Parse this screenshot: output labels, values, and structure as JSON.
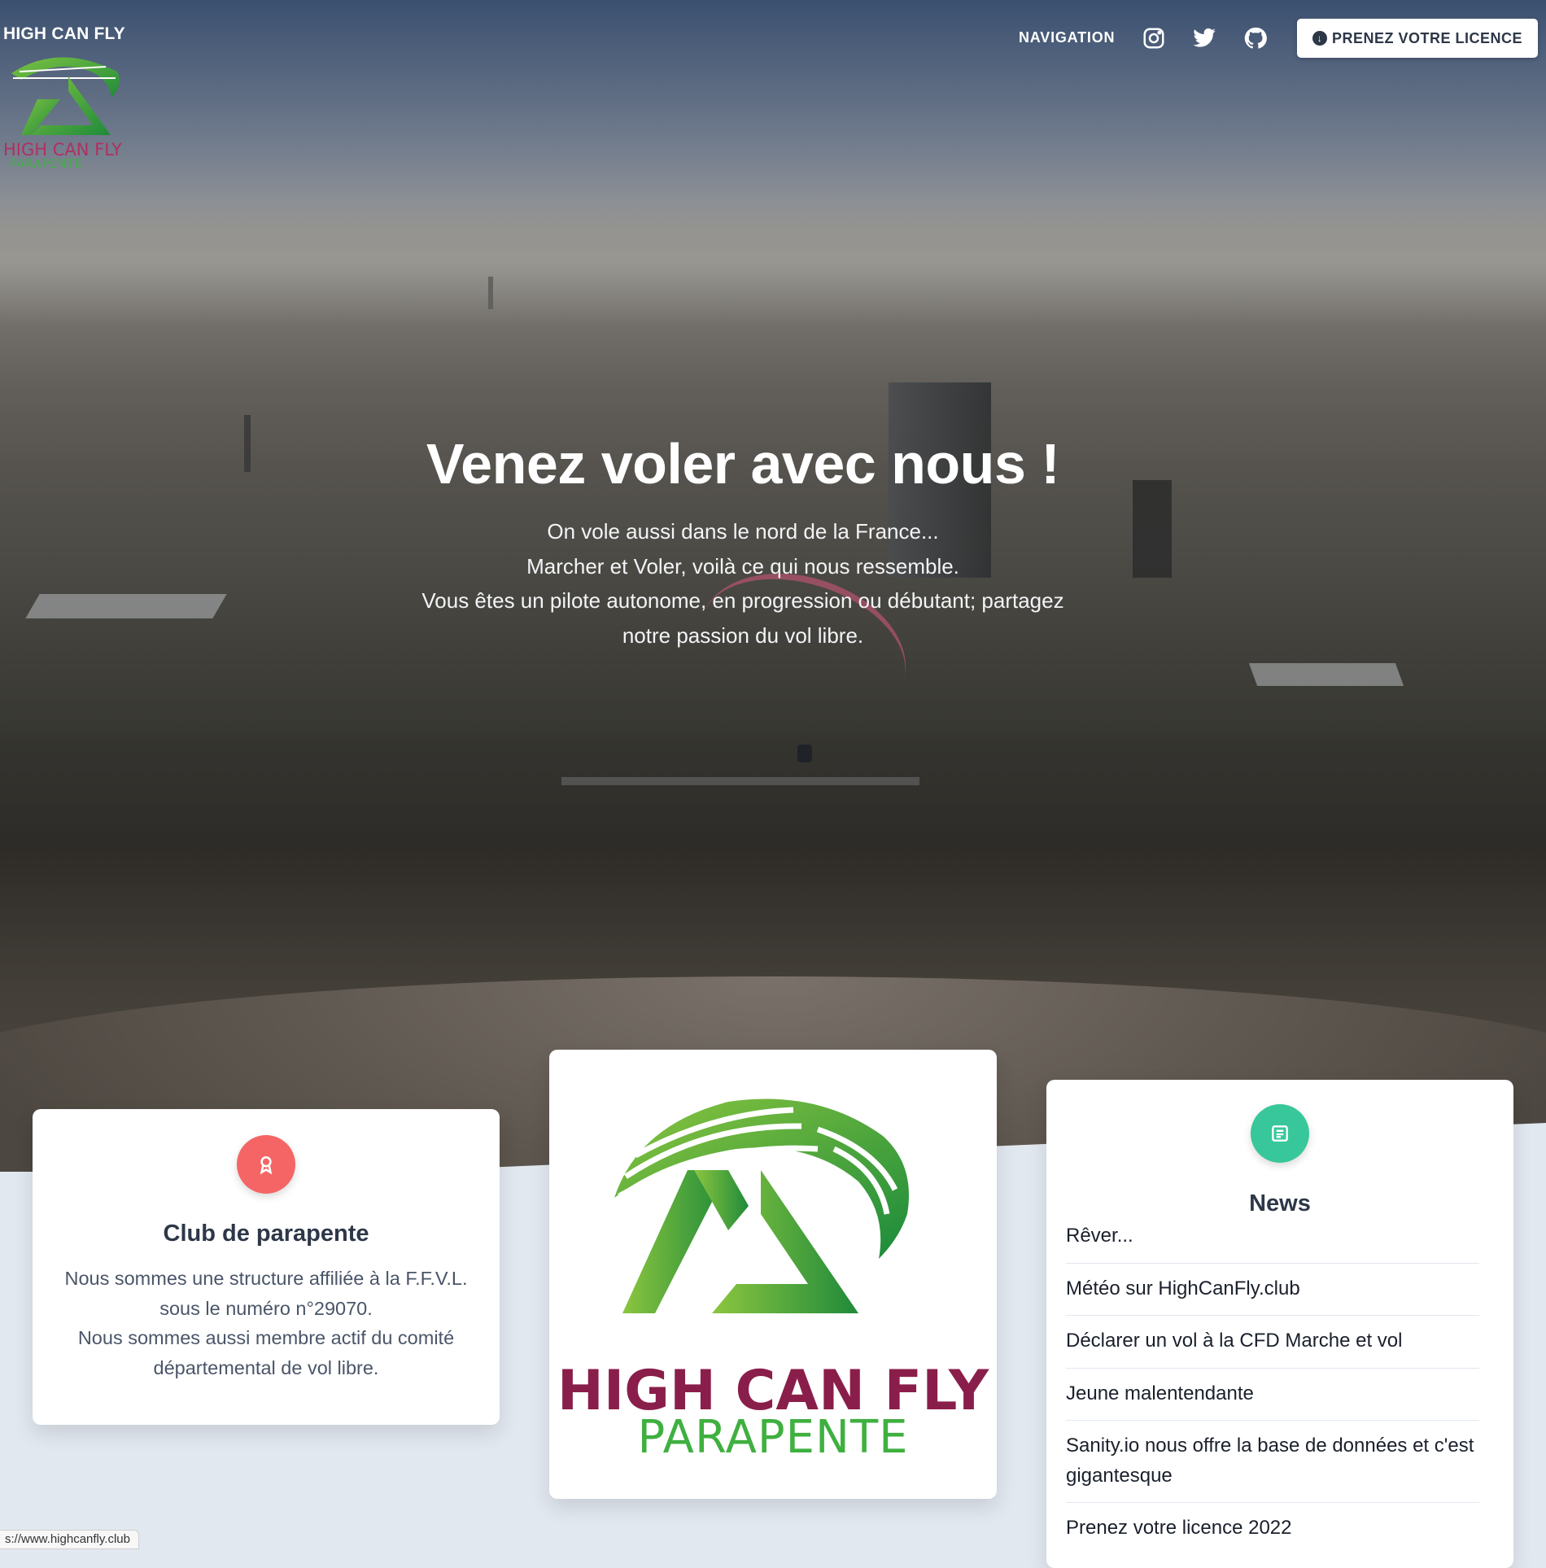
{
  "header": {
    "brand": "HIGH CAN FLY",
    "logo_title": "HIGH CAN FLY",
    "logo_subtitle": "PARAPENTE",
    "nav_link": "NAVIGATION",
    "social_icons": [
      "instagram-icon",
      "twitter-icon",
      "github-icon"
    ],
    "cta_label": "PRENEZ VOTRE LICENCE"
  },
  "hero": {
    "title": "Venez voler avec nous !",
    "lines": [
      "On vole aussi dans le nord de la France...",
      "Marcher et Voler, voilà ce qui nous ressemble.",
      "Vous êtes un pilote autonome, en progression ou débutant; partagez",
      "notre passion du vol libre."
    ]
  },
  "cards": {
    "club": {
      "icon": "award-icon",
      "title": "Club de parapente",
      "lines": [
        "Nous sommes une structure affiliée à la F.F.V.L.",
        "sous le numéro n°29070.",
        "Nous sommes aussi membre actif du comité",
        "départemental de vol libre."
      ]
    },
    "logo": {
      "title": "HIGH CAN FLY",
      "subtitle": "PARAPENTE"
    },
    "news": {
      "icon": "newspaper-icon",
      "title": "News",
      "items": [
        "Rêver...",
        "Météo sur HighCanFly.club",
        "Déclarer un vol à la CFD Marche et vol",
        "Jeune malentendante",
        "Sanity.io nous offre la base de données et c'est gigantesque",
        "Prenez votre licence 2022"
      ]
    }
  },
  "colors": {
    "accent_red": "#f56565",
    "accent_green": "#38c79a",
    "logo_green": "#3fb040",
    "logo_burgundy": "#8a1e4a",
    "text_dark": "#2d3748"
  },
  "status_bar": {
    "url": "s://www.highcanfly.club"
  }
}
